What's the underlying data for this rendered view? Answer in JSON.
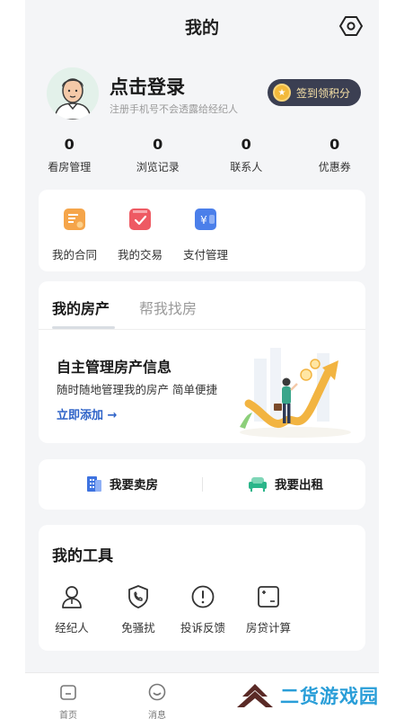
{
  "header": {
    "title": "我的",
    "settings_icon": "settings-hexagon-icon"
  },
  "profile": {
    "title": "点击登录",
    "subtitle": "注册手机号不会透露给经纪人",
    "avatar_icon": "user-avatar-icon",
    "checkin_label": "签到领积分",
    "checkin_icon": "star-coin-icon"
  },
  "stats": [
    {
      "value": "0",
      "label": "看房管理"
    },
    {
      "value": "0",
      "label": "浏览记录"
    },
    {
      "value": "0",
      "label": "联系人"
    },
    {
      "value": "0",
      "label": "优惠券"
    }
  ],
  "quick_actions": [
    {
      "label": "我的合同",
      "icon": "contract-icon",
      "color": "#f5a54a"
    },
    {
      "label": "我的交易",
      "icon": "transaction-check-icon",
      "color": "#ee5a63"
    },
    {
      "label": "支付管理",
      "icon": "payment-yuan-icon",
      "color": "#4b7fea"
    }
  ],
  "property": {
    "tabs": [
      {
        "label": "我的房产"
      },
      {
        "label": "帮我找房"
      }
    ],
    "heading": "自主管理房产信息",
    "description": "随时随地管理我的房产 简单便捷",
    "link": "立即添加 →"
  },
  "sell_rent": [
    {
      "label": "我要卖房",
      "icon": "building-sell-icon",
      "color": "#3e73e0"
    },
    {
      "label": "我要出租",
      "icon": "sofa-rent-icon",
      "color": "#2bb58a"
    }
  ],
  "tools": {
    "title": "我的工具",
    "items": [
      {
        "label": "经纪人",
        "icon": "agent-person-icon"
      },
      {
        "label": "免骚扰",
        "icon": "shield-phone-icon"
      },
      {
        "label": "投诉反馈",
        "icon": "exclamation-circle-icon"
      },
      {
        "label": "房贷计算",
        "icon": "calculator-icon"
      }
    ]
  },
  "tabbar": [
    {
      "label": "首页",
      "icon": "home-icon"
    },
    {
      "label": "消息",
      "icon": "message-smile-icon"
    }
  ],
  "watermark": {
    "text": "二货游戏园"
  },
  "colors": {
    "page_bg": "#f4f5f7",
    "card_bg": "#ffffff",
    "checkin_bg": "#3b3f52",
    "checkin_text": "#f6e0a6",
    "link_blue": "#2e63c8",
    "watermark_blue": "#2a9ed8"
  }
}
